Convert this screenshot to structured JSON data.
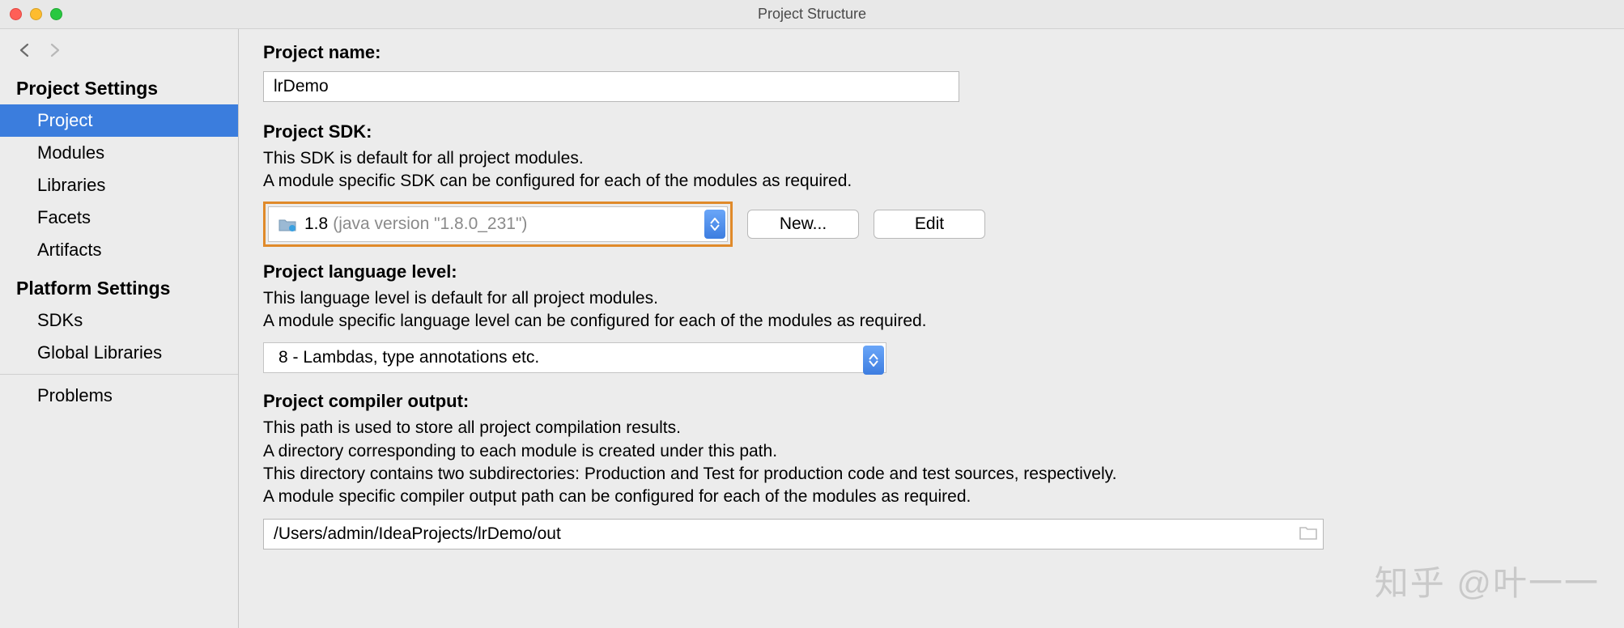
{
  "window": {
    "title": "Project Structure"
  },
  "sidebar": {
    "sections": [
      {
        "heading": "Project Settings",
        "items": [
          {
            "label": "Project",
            "selected": true
          },
          {
            "label": "Modules",
            "selected": false
          },
          {
            "label": "Libraries",
            "selected": false
          },
          {
            "label": "Facets",
            "selected": false
          },
          {
            "label": "Artifacts",
            "selected": false
          }
        ]
      },
      {
        "heading": "Platform Settings",
        "items": [
          {
            "label": "SDKs",
            "selected": false
          },
          {
            "label": "Global Libraries",
            "selected": false
          }
        ]
      }
    ],
    "problems": "Problems"
  },
  "main": {
    "project_name": {
      "label": "Project name:",
      "value": "lrDemo"
    },
    "project_sdk": {
      "label": "Project SDK:",
      "desc1": "This SDK is default for all project modules.",
      "desc2": "A module specific SDK can be configured for each of the modules as required.",
      "selected_name": "1.8",
      "selected_detail": "(java version \"1.8.0_231\")",
      "new_btn": "New...",
      "edit_btn": "Edit"
    },
    "lang_level": {
      "label": "Project language level:",
      "desc1": "This language level is default for all project modules.",
      "desc2": "A module specific language level can be configured for each of the modules as required.",
      "selected": "8 - Lambdas, type annotations etc."
    },
    "compiler_out": {
      "label": "Project compiler output:",
      "desc1": "This path is used to store all project compilation results.",
      "desc2": "A directory corresponding to each module is created under this path.",
      "desc3": "This directory contains two subdirectories: Production and Test for production code and test sources, respectively.",
      "desc4": "A module specific compiler output path can be configured for each of the modules as required.",
      "value": "/Users/admin/IdeaProjects/lrDemo/out"
    }
  },
  "watermark": "知乎 @叶一一"
}
